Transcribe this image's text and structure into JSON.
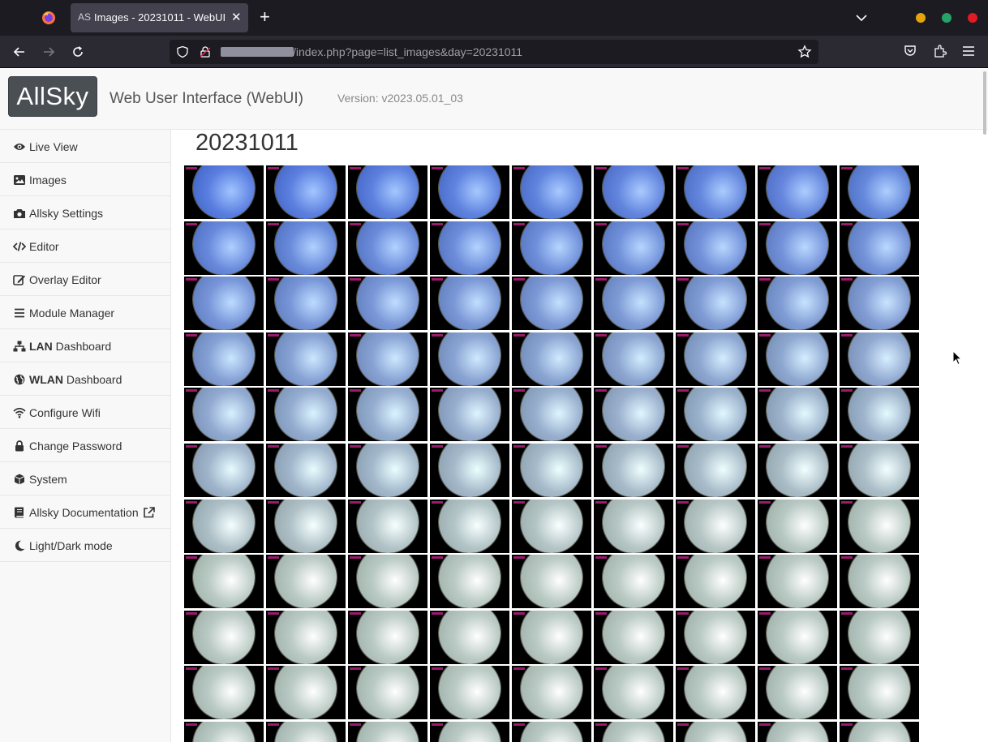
{
  "browser": {
    "tab": {
      "favicon_text": "AS",
      "title": "Images - 20231011 - WebUI"
    },
    "url_visible": "/index.php?page=list_images&day=20231011"
  },
  "header": {
    "logo_text": "AllSky",
    "app_name": "Web User Interface (WebUI)",
    "version": "Version: v2023.05.01_03"
  },
  "sidebar": {
    "items": [
      {
        "icon": "eye-icon",
        "label": "Live View"
      },
      {
        "icon": "image-icon",
        "label": "Images"
      },
      {
        "icon": "camera-icon",
        "label": "Allsky Settings"
      },
      {
        "icon": "code-icon",
        "label": "Editor"
      },
      {
        "icon": "edit-icon",
        "label": "Overlay Editor"
      },
      {
        "icon": "bars-icon",
        "label": "Module Manager"
      },
      {
        "icon": "network-icon",
        "label_bold": "LAN",
        "label": " Dashboard"
      },
      {
        "icon": "globe-icon",
        "label_bold": "WLAN",
        "label": " Dashboard"
      },
      {
        "icon": "wifi-icon",
        "label": "Configure Wifi"
      },
      {
        "icon": "lock-icon",
        "label": "Change Password"
      },
      {
        "icon": "cube-icon",
        "label": "System"
      },
      {
        "icon": "book-icon",
        "label": "Allsky Documentation",
        "trailing_icon": "external-link-icon"
      },
      {
        "icon": "moon-icon",
        "label": "Light/Dark mode"
      }
    ]
  },
  "main": {
    "title": "20231011",
    "thumbnail_grid": {
      "columns": 9,
      "visible_rows": 11
    }
  },
  "colors": {
    "browser_tabbar": "#1c1b22",
    "browser_toolbar": "#2b2a33",
    "sidebar_bg": "#f8f8f8",
    "logo_bg": "#4a4f54",
    "sky_early": "#5b7fe0",
    "sky_late": "#b9c9c4"
  }
}
